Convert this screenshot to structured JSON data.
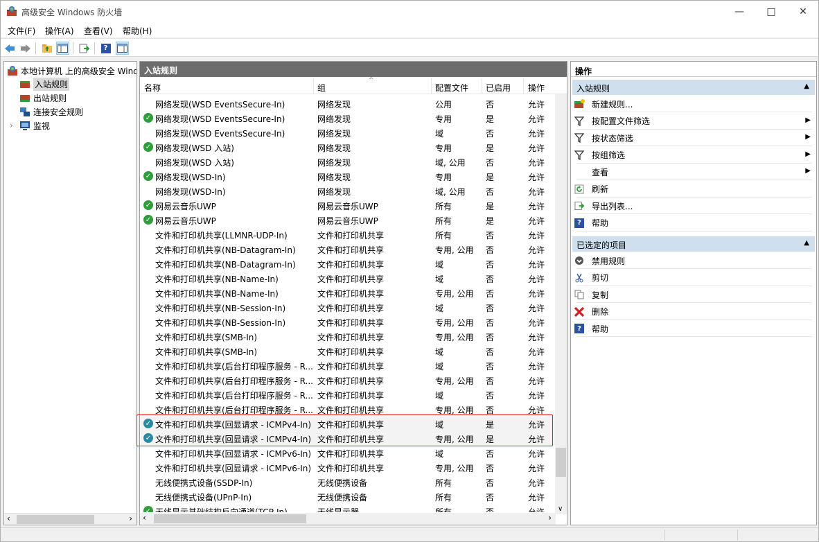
{
  "window": {
    "title": "高级安全 Windows 防火墙"
  },
  "menu": [
    "文件(F)",
    "操作(A)",
    "查看(V)",
    "帮助(H)"
  ],
  "tree": {
    "root": "本地计算机 上的高级安全 Windows 防火墙",
    "items": [
      "入站规则",
      "出站规则",
      "连接安全规则",
      "监视"
    ]
  },
  "center": {
    "header": "入站规则",
    "columns": [
      "名称",
      "组",
      "配置文件",
      "已启用",
      "操作"
    ],
    "rows": [
      {
        "enabled_icon": false,
        "name": "网络发现(WSD EventsSecure-In)",
        "group": "网络发现",
        "profile": "公用",
        "enabled": "否",
        "action": "允许"
      },
      {
        "enabled_icon": true,
        "name": "网络发现(WSD EventsSecure-In)",
        "group": "网络发现",
        "profile": "专用",
        "enabled": "是",
        "action": "允许"
      },
      {
        "enabled_icon": false,
        "name": "网络发现(WSD EventsSecure-In)",
        "group": "网络发现",
        "profile": "域",
        "enabled": "否",
        "action": "允许"
      },
      {
        "enabled_icon": true,
        "name": "网络发现(WSD 入站)",
        "group": "网络发现",
        "profile": "专用",
        "enabled": "是",
        "action": "允许"
      },
      {
        "enabled_icon": false,
        "name": "网络发现(WSD 入站)",
        "group": "网络发现",
        "profile": "域, 公用",
        "enabled": "否",
        "action": "允许"
      },
      {
        "enabled_icon": true,
        "name": "网络发现(WSD-In)",
        "group": "网络发现",
        "profile": "专用",
        "enabled": "是",
        "action": "允许"
      },
      {
        "enabled_icon": false,
        "name": "网络发现(WSD-In)",
        "group": "网络发现",
        "profile": "域, 公用",
        "enabled": "否",
        "action": "允许"
      },
      {
        "enabled_icon": true,
        "name": "网易云音乐UWP",
        "group": "网易云音乐UWP",
        "profile": "所有",
        "enabled": "是",
        "action": "允许"
      },
      {
        "enabled_icon": true,
        "name": "网易云音乐UWP",
        "group": "网易云音乐UWP",
        "profile": "所有",
        "enabled": "是",
        "action": "允许"
      },
      {
        "enabled_icon": false,
        "name": "文件和打印机共享(LLMNR-UDP-In)",
        "group": "文件和打印机共享",
        "profile": "所有",
        "enabled": "否",
        "action": "允许"
      },
      {
        "enabled_icon": false,
        "name": "文件和打印机共享(NB-Datagram-In)",
        "group": "文件和打印机共享",
        "profile": "专用, 公用",
        "enabled": "否",
        "action": "允许"
      },
      {
        "enabled_icon": false,
        "name": "文件和打印机共享(NB-Datagram-In)",
        "group": "文件和打印机共享",
        "profile": "域",
        "enabled": "否",
        "action": "允许"
      },
      {
        "enabled_icon": false,
        "name": "文件和打印机共享(NB-Name-In)",
        "group": "文件和打印机共享",
        "profile": "域",
        "enabled": "否",
        "action": "允许"
      },
      {
        "enabled_icon": false,
        "name": "文件和打印机共享(NB-Name-In)",
        "group": "文件和打印机共享",
        "profile": "专用, 公用",
        "enabled": "否",
        "action": "允许"
      },
      {
        "enabled_icon": false,
        "name": "文件和打印机共享(NB-Session-In)",
        "group": "文件和打印机共享",
        "profile": "域",
        "enabled": "否",
        "action": "允许"
      },
      {
        "enabled_icon": false,
        "name": "文件和打印机共享(NB-Session-In)",
        "group": "文件和打印机共享",
        "profile": "专用, 公用",
        "enabled": "否",
        "action": "允许"
      },
      {
        "enabled_icon": false,
        "name": "文件和打印机共享(SMB-In)",
        "group": "文件和打印机共享",
        "profile": "专用, 公用",
        "enabled": "否",
        "action": "允许"
      },
      {
        "enabled_icon": false,
        "name": "文件和打印机共享(SMB-In)",
        "group": "文件和打印机共享",
        "profile": "域",
        "enabled": "否",
        "action": "允许"
      },
      {
        "enabled_icon": false,
        "name": "文件和打印机共享(后台打印程序服务 - R...",
        "group": "文件和打印机共享",
        "profile": "域",
        "enabled": "否",
        "action": "允许"
      },
      {
        "enabled_icon": false,
        "name": "文件和打印机共享(后台打印程序服务 - R...",
        "group": "文件和打印机共享",
        "profile": "专用, 公用",
        "enabled": "否",
        "action": "允许"
      },
      {
        "enabled_icon": false,
        "name": "文件和打印机共享(后台打印程序服务 - R...",
        "group": "文件和打印机共享",
        "profile": "域",
        "enabled": "否",
        "action": "允许"
      },
      {
        "enabled_icon": false,
        "name": "文件和打印机共享(后台打印程序服务 - R...",
        "group": "文件和打印机共享",
        "profile": "专用, 公用",
        "enabled": "否",
        "action": "允许"
      },
      {
        "enabled_icon": true,
        "highlight": true,
        "name": "文件和打印机共享(回显请求 - ICMPv4-In)",
        "group": "文件和打印机共享",
        "profile": "域",
        "enabled": "是",
        "action": "允许"
      },
      {
        "enabled_icon": true,
        "highlight": true,
        "name": "文件和打印机共享(回显请求 - ICMPv4-In)",
        "group": "文件和打印机共享",
        "profile": "专用, 公用",
        "enabled": "是",
        "action": "允许"
      },
      {
        "enabled_icon": false,
        "name": "文件和打印机共享(回显请求 - ICMPv6-In)",
        "group": "文件和打印机共享",
        "profile": "域",
        "enabled": "否",
        "action": "允许"
      },
      {
        "enabled_icon": false,
        "name": "文件和打印机共享(回显请求 - ICMPv6-In)",
        "group": "文件和打印机共享",
        "profile": "专用, 公用",
        "enabled": "否",
        "action": "允许"
      },
      {
        "enabled_icon": false,
        "name": "无线便携式设备(SSDP-In)",
        "group": "无线便携设备",
        "profile": "所有",
        "enabled": "否",
        "action": "允许"
      },
      {
        "enabled_icon": false,
        "name": "无线便携式设备(UPnP-In)",
        "group": "无线便携设备",
        "profile": "所有",
        "enabled": "否",
        "action": "允许"
      },
      {
        "enabled_icon": true,
        "name": "无线显示基础结构反向通道(TCP-In)",
        "group": "无线显示器",
        "profile": "所有",
        "enabled": "否",
        "action": "允许"
      }
    ]
  },
  "actions": {
    "title": "操作",
    "section1": {
      "label": "入站规则",
      "items": [
        {
          "label": "新建规则...",
          "icon": "new-rule-icon"
        },
        {
          "label": "按配置文件筛选",
          "icon": "filter-icon",
          "submenu": true
        },
        {
          "label": "按状态筛选",
          "icon": "filter-icon",
          "submenu": true
        },
        {
          "label": "按组筛选",
          "icon": "filter-icon",
          "submenu": true
        },
        {
          "label": "查看",
          "icon": "",
          "submenu": true
        },
        {
          "label": "刷新",
          "icon": "refresh-icon"
        },
        {
          "label": "导出列表...",
          "icon": "export-icon"
        },
        {
          "label": "帮助",
          "icon": "help-icon"
        }
      ]
    },
    "section2": {
      "label": "已选定的项目",
      "items": [
        {
          "label": "禁用规则",
          "icon": "disable-icon"
        },
        {
          "label": "剪切",
          "icon": "cut-icon"
        },
        {
          "label": "复制",
          "icon": "copy-icon"
        },
        {
          "label": "删除",
          "icon": "delete-icon"
        },
        {
          "label": "帮助",
          "icon": "help-icon"
        }
      ]
    }
  },
  "colors": {
    "highlight_box": "#e02020",
    "section_bg": "#cfdfee",
    "header_bg": "#6d6d6d",
    "enabled_green": "#2e9e3b"
  }
}
